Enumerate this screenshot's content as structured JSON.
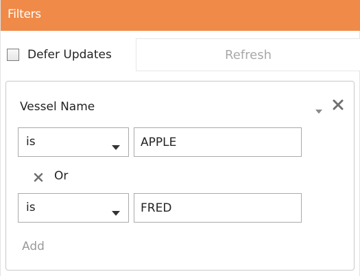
{
  "header": {
    "title": "Filters"
  },
  "toolbar": {
    "defer_label": "Defer Updates",
    "defer_checked": false,
    "refresh_label": "Refresh"
  },
  "filter": {
    "field_label": "Vessel Name",
    "conditions": [
      {
        "operator": "is",
        "value": "APPLE"
      },
      {
        "operator": "is",
        "value": "FRED"
      }
    ],
    "joiner": "Or",
    "add_label": "Add"
  },
  "icons": {
    "panel_menu": "chevron-down-icon",
    "panel_close": "close-icon",
    "dropdown_arrow": "triangle-down-icon",
    "remove_condition": "close-icon"
  },
  "colors": {
    "header_bg": "#f08a48",
    "header_text": "#ffffff",
    "disabled_text": "#a8a8a8",
    "border": "#a9a9a9"
  }
}
